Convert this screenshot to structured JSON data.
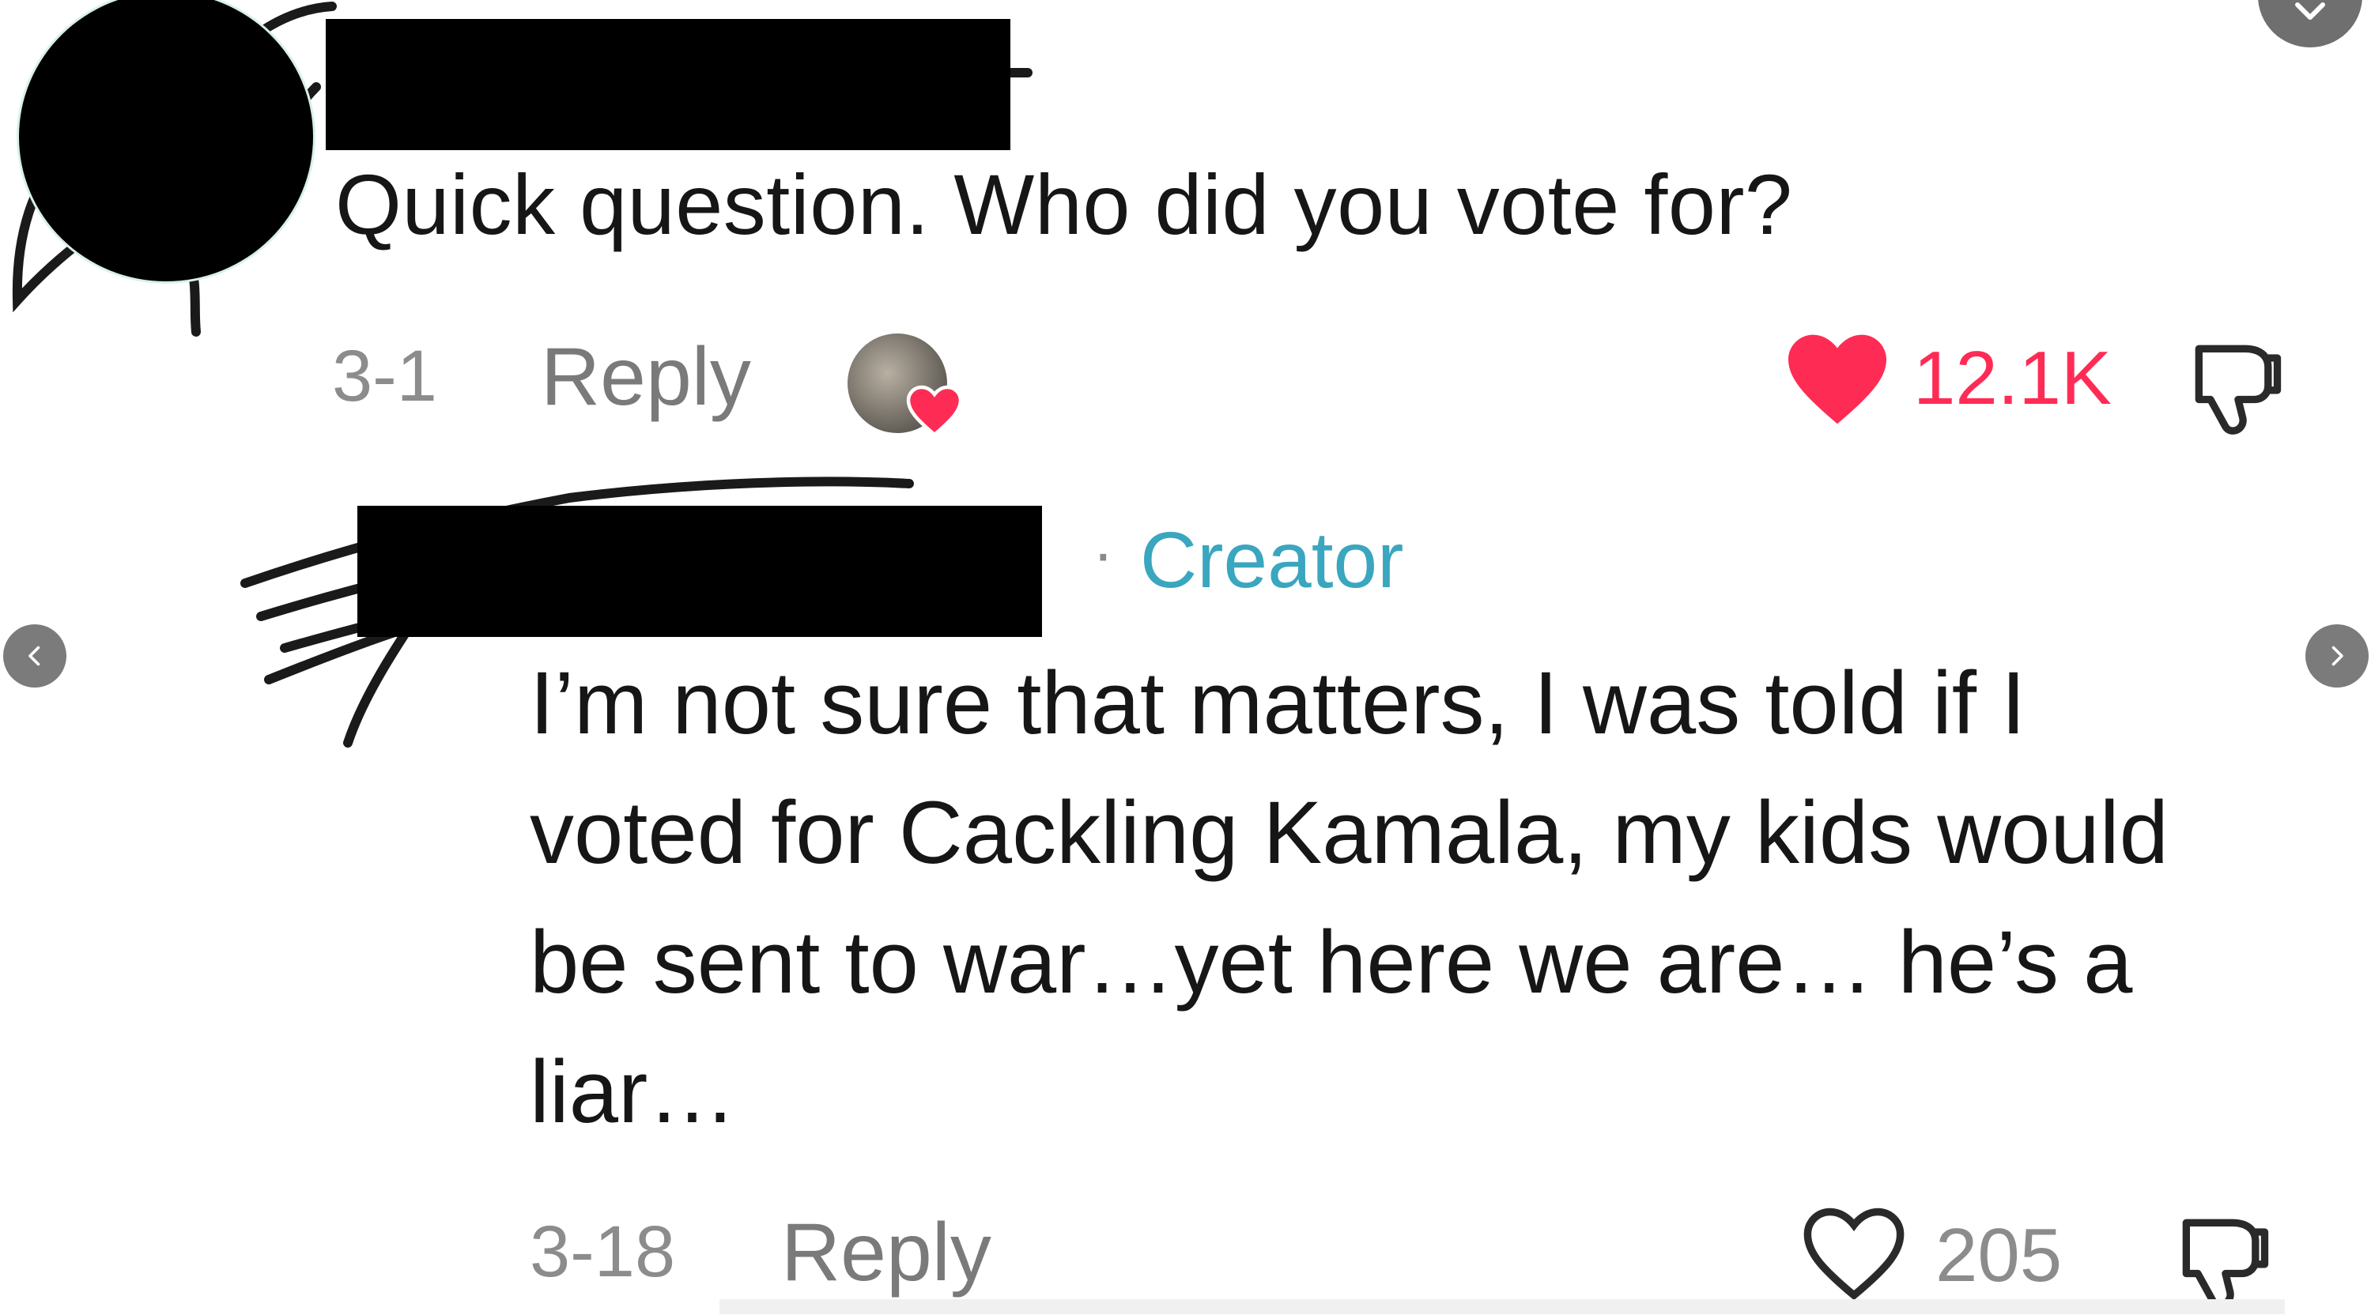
{
  "comment": {
    "text": "Quick question. Who did you vote for?",
    "date": "3-1",
    "reply_label": "Reply",
    "like_count": "12.1K",
    "liked": true
  },
  "reply": {
    "author_badge": "Creator",
    "badge_separator": "·",
    "text": "I’m not sure that matters, I was told if I voted for Cackling Kamala, my kids would be sent to war…yet here we are… he’s a liar…",
    "date": "3-18",
    "reply_label": "Reply",
    "like_count": "205",
    "liked": false
  },
  "icons": {
    "like": "heart-icon",
    "dislike": "thumbs-down-icon",
    "prev": "chevron-left-icon",
    "next": "chevron-right-icon",
    "close": "close-icon"
  },
  "colors": {
    "like_active": "#fe2c55",
    "creator_badge": "#3aa6bf",
    "meta_text": "#8c8c8c",
    "body_text": "#161616"
  }
}
